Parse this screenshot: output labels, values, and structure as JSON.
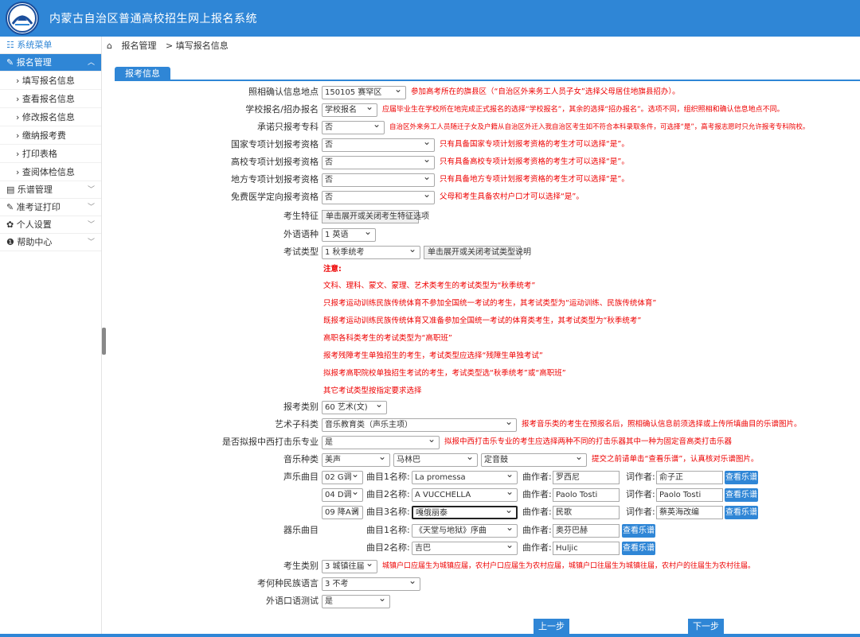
{
  "header": {
    "title": "内蒙古自治区普通高校招生网上报名系统"
  },
  "sidebar": {
    "menu_title": "系统菜单",
    "sections": [
      {
        "label": "报名管理",
        "icon": "edit-icon",
        "active": true
      },
      {
        "label": "乐谱管理",
        "icon": "list-icon"
      },
      {
        "label": "准考证打印",
        "icon": "edit-icon"
      },
      {
        "label": "个人设置",
        "icon": "gear-icon"
      },
      {
        "label": "帮助中心",
        "icon": "info-icon"
      }
    ],
    "items": [
      "› 填写报名信息",
      "› 查看报名信息",
      "› 修改报名信息",
      "› 缴纳报考费",
      "› 打印表格",
      "› 查阅体检信息"
    ]
  },
  "breadcrumb": {
    "root": "报名管理",
    "current": "> 填写报名信息"
  },
  "tab": {
    "label": "报考信息"
  },
  "form": {
    "r1": {
      "label": "照相确认信息地点",
      "value": "150105 赛罕区",
      "hint": "参加高考所在的旗县区（“自治区外来务工人员子女”选择父母居住地旗县招办）。"
    },
    "r2": {
      "label": "学校报名/招办报名",
      "value": "学校报名",
      "hint": "应届毕业生在学校所在地完成正式报名的选择“学校报名”，其余的选择“招办报名”。选项不同，组织照相和确认信息地点不同。"
    },
    "r3": {
      "label": "承诺只报考专科",
      "value": "否",
      "hint": "自治区外来务工人员随迁子女及户籍从自治区外迁入我自治区考生如不符合本科录取条件，可选择“是”，高考报志愿时只允许报考专科院校。"
    },
    "r4": {
      "label": "国家专项计划报考资格",
      "value": "否",
      "hint": "只有具备国家专项计划报考资格的考生才可以选择“是”。"
    },
    "r5": {
      "label": "高校专项计划报考资格",
      "value": "否",
      "hint": "只有具备高校专项计划报考资格的考生才可以选择“是”。"
    },
    "r6": {
      "label": "地方专项计划报考资格",
      "value": "否",
      "hint": "只有具备地方专项计划报考资格的考生才可以选择“是”。"
    },
    "r7": {
      "label": "免费医学定向报考资格",
      "value": "否",
      "hint": "父母和考生具备农村户口才可以选择“是”。"
    },
    "r8": {
      "label": "考生特征",
      "button": "单击展开或关闭考生特征选项"
    },
    "r9": {
      "label": "外语语种",
      "value": "1 英语"
    },
    "r10": {
      "label": "考试类型",
      "value": "1 秋季统考",
      "button": "单击展开或关闭考试类型说明"
    },
    "notes": [
      "注意:",
      "文科、理科、蒙文、蒙理、艺术类考生的考试类型为“秋季统考”",
      "只报考运动训练民族传统体育不参加全国统一考试的考生，其考试类型为“运动训练、民族传统体育”",
      "既报考运动训练民族传统体育又准备参加全国统一考试的体育类考生，其考试类型为“秋季统考”",
      "高职各科类考生的考试类型为“高职班”",
      "报考残障考生单独招生的考生，考试类型应选择“残障生单独考试”",
      "拟报考高职院校单独招生考试的考生，考试类型选“秋季统考”或“高职班”",
      "其它考试类型按指定要求选择"
    ],
    "r11": {
      "label": "报考类别",
      "value": "60 艺术(文)"
    },
    "r12": {
      "label": "艺术子科类",
      "value": "音乐教育类（声乐主项）",
      "hint": "报考音乐类的考生在预报名后，照相确认信息前须选择或上传所填曲目的乐谱图片。"
    },
    "r13": {
      "label": "是否拟报中西打击乐专业",
      "value": "是",
      "hint": "拟报中西打击乐专业的考生应选择两种不同的打击乐器其中一种为固定音高类打击乐器"
    },
    "r14": {
      "label": "音乐种类",
      "v1": "美声",
      "v2": "马林巴",
      "v3": "定音鼓",
      "hint": "提交之前请单击“查看乐谱”，认真核对乐谱图片。"
    },
    "vocal": {
      "label": "声乐曲目",
      "rows": [
        {
          "key": "02 G调",
          "name_label": "曲目1名称:",
          "name": "La promessa",
          "composer_label": "曲作者:",
          "composer": "罗西尼",
          "lyricist_label": "词作者:",
          "lyricist": "俞子正",
          "btn": "查看乐谱"
        },
        {
          "key": "04 D调",
          "name_label": "曲目2名称:",
          "name": "A VUCCHELLA",
          "composer_label": "曲作者:",
          "composer": "Paolo Tosti",
          "lyricist_label": "词作者:",
          "lyricist": "Paolo Tosti",
          "btn": "查看乐谱"
        },
        {
          "key": "09 降A调",
          "name_label": "曲目3名称:",
          "name": "嘎俄丽泰",
          "composer_label": "曲作者:",
          "composer": "民歌",
          "lyricist_label": "词作者:",
          "lyricist": "蔡英海改编",
          "btn": "查看乐谱"
        }
      ]
    },
    "instr": {
      "label": "器乐曲目",
      "rows": [
        {
          "name_label": "曲目1名称:",
          "name": "《天堂与地狱》序曲",
          "composer_label": "曲作者:",
          "composer": "奥芬巴赫",
          "btn": "查看乐谱"
        },
        {
          "name_label": "曲目2名称:",
          "name": "吉巴",
          "composer_label": "曲作者:",
          "composer": "Huljic",
          "btn": "查看乐谱"
        }
      ]
    },
    "r15": {
      "label": "考生类别",
      "value": "3 城镇往届",
      "hint": "城镇户口应届生为城镇应届，农村户口应届生为农村应届，城镇户口往届生为城镇往届，农村户的往届生为农村往届。"
    },
    "r16": {
      "label": "考何种民族语言",
      "value": "3 不考"
    },
    "r17": {
      "label": "外语口语测试",
      "value": "是"
    },
    "prev": "上一步",
    "next": "下一步"
  }
}
